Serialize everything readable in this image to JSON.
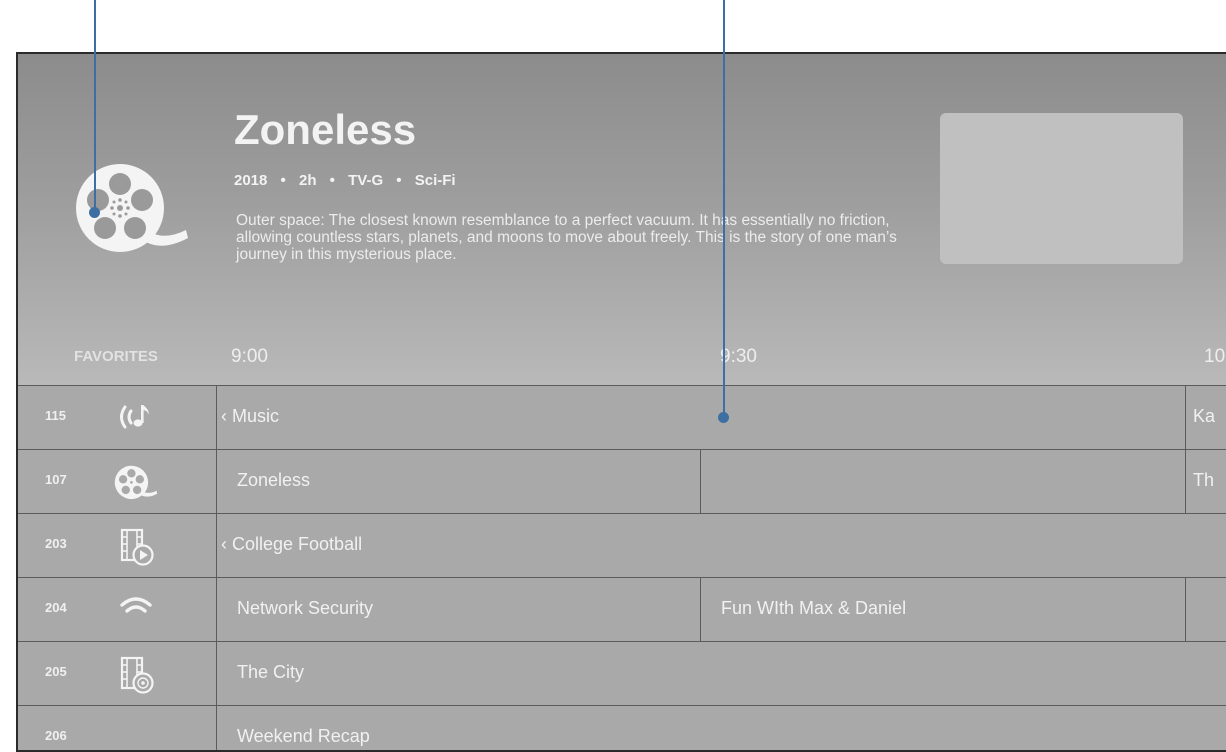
{
  "hero": {
    "title": "Zoneless",
    "year": "2018",
    "duration": "2h",
    "rating": "TV-G",
    "genre": "Sci-Fi",
    "separator": "•",
    "description": "Outer space: The closest known resemblance to a perfect vacuum. It has essentially no friction, allowing countless stars, planets, and moons to move about freely. This is the story of one man’s journey in this mysterious place.",
    "icon": "film-reel-icon"
  },
  "guide": {
    "favorites_label": "FAVORITES",
    "times": [
      "9:00",
      "9:30",
      "10"
    ]
  },
  "channels": [
    {
      "number": "115",
      "icon": "music-broadcast-icon",
      "programs": [
        "‹ Music",
        "Ka"
      ]
    },
    {
      "number": "107",
      "icon": "film-reel-icon",
      "programs": [
        "Zoneless",
        "",
        "Th"
      ]
    },
    {
      "number": "203",
      "icon": "film-play-icon",
      "programs": [
        "‹ College Football"
      ]
    },
    {
      "number": "204",
      "icon": "wifi-icon",
      "programs": [
        "Network Security",
        "Fun WIth Max & Daniel",
        ""
      ]
    },
    {
      "number": "205",
      "icon": "film-disc-icon",
      "programs": [
        "The City"
      ]
    },
    {
      "number": "206",
      "icon": "",
      "programs": [
        "Weekend Recap"
      ]
    }
  ],
  "colors": {
    "callout": "#3d6fa3",
    "grid_bg": "#a9a9a9",
    "preview": "#c0c0c0",
    "border": "#5b5b5b"
  }
}
